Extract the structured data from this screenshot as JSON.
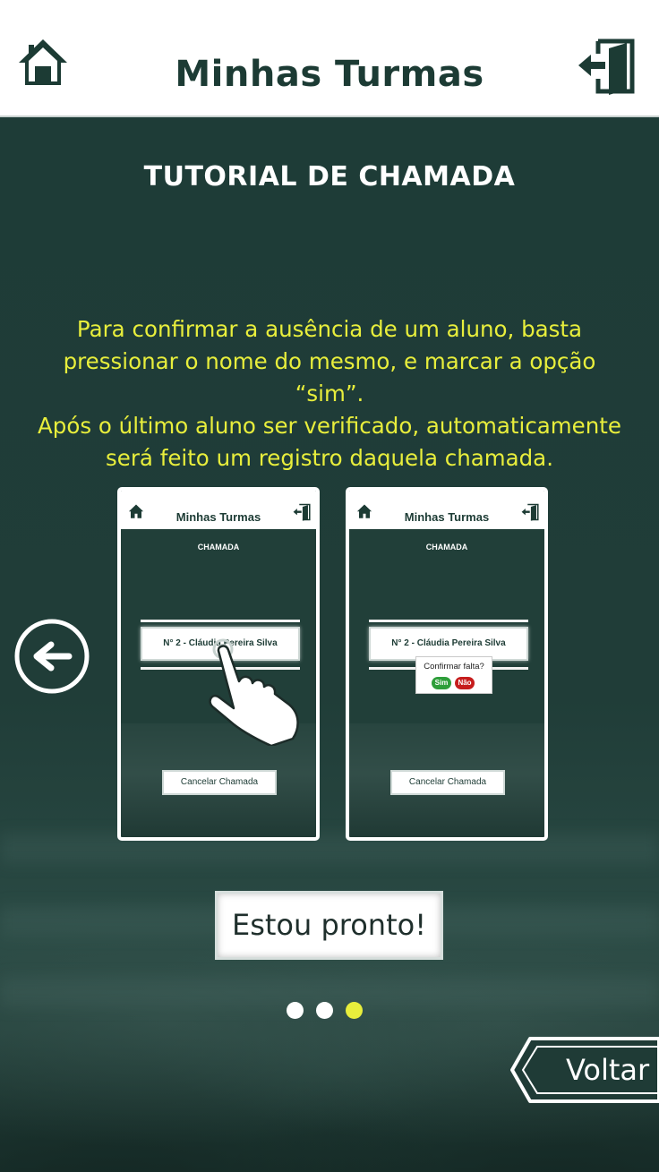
{
  "header": {
    "title": "Minhas Turmas",
    "home_icon": "home-icon",
    "logout_icon": "logout-door-icon"
  },
  "tutorial": {
    "title": "TUTORIAL DE CHAMADA",
    "description_lines": [
      "Para confirmar a ausência de um aluno, basta",
      "pressionar o nome do mesmo, e marcar a opção “sim”.",
      "Após o último aluno ser verificado, automaticamente",
      "será feito um registro daquela chamada."
    ]
  },
  "screens": [
    {
      "header_title": "Minhas Turmas",
      "section_title": "CHAMADA",
      "student": "N° 2 - Cláudia Pereira Silva",
      "cancel_label": "Cancelar Chamada",
      "overlay": "tap-hand-icon"
    },
    {
      "header_title": "Minhas Turmas",
      "section_title": "CHAMADA",
      "student": "N° 2 - Cláudia Pereira Silva",
      "cancel_label": "Cancelar Chamada",
      "popup": {
        "question": "Confirmar falta?",
        "yes_label": "Sim",
        "no_label": "Não"
      }
    }
  ],
  "navigation": {
    "prev_icon": "arrow-left-circle-icon",
    "ready_label": "Estou pronto!",
    "back_label": "Voltar",
    "pager": {
      "total": 3,
      "active": 3
    }
  },
  "colors": {
    "accent": "#e8ee3c",
    "dark_green": "#1c3b34",
    "background": "#1f3b36",
    "yes": "#2e9e3a",
    "no": "#c61d1d"
  }
}
